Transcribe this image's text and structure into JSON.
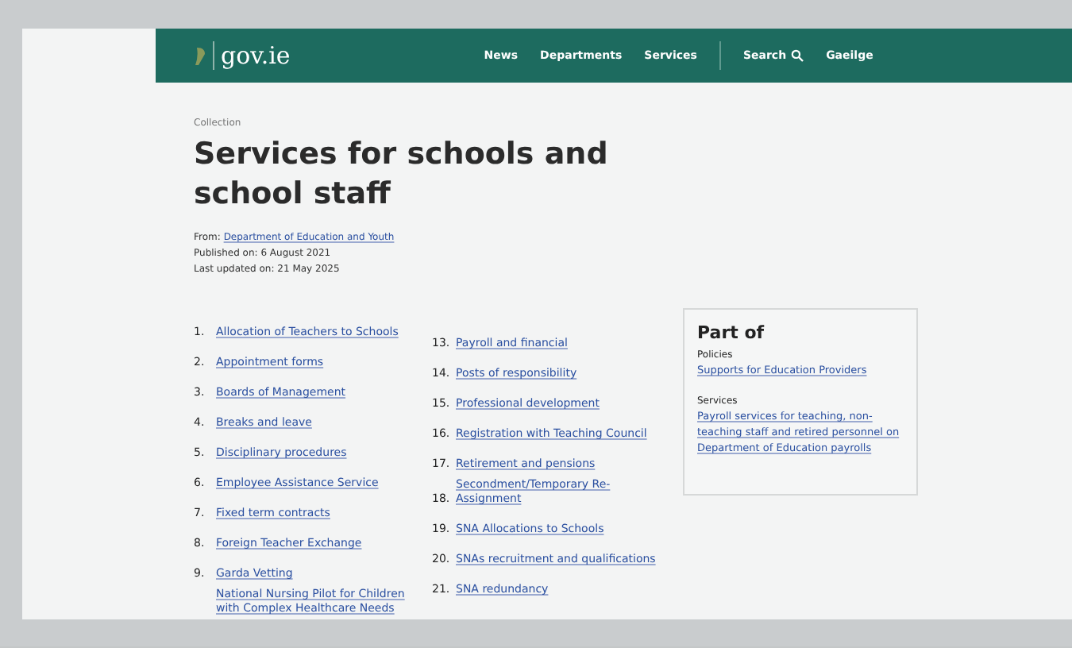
{
  "header": {
    "logo": "gov.ie",
    "nav": [
      {
        "label": "News",
        "kind": "link"
      },
      {
        "label": "Departments",
        "kind": "link"
      },
      {
        "label": "Services",
        "kind": "link"
      },
      {
        "kind": "divider"
      },
      {
        "label": "Search",
        "kind": "search"
      },
      {
        "label": "Gaeilge",
        "kind": "link"
      }
    ]
  },
  "page": {
    "label": "Collection",
    "title": "Services for schools and school staff",
    "from_label": "From:",
    "from_link": "Department of Education and Youth",
    "published": "Published on: 6 August 2021",
    "updated": "Last updated on: 21 May 2025"
  },
  "columns": [
    [
      {
        "number": "1.",
        "text": "Allocation of Teachers to Schools"
      },
      {
        "number": "2.",
        "text": "Appointment forms"
      },
      {
        "number": "3.",
        "text": "Boards of Management"
      },
      {
        "number": "4.",
        "text": "Breaks and leave"
      },
      {
        "number": "5.",
        "text": "Disciplinary procedures"
      },
      {
        "number": "6.",
        "text": "Employee Assistance Service"
      },
      {
        "number": "7.",
        "text": "Fixed term contracts"
      },
      {
        "number": "8.",
        "text": "Foreign Teacher Exchange"
      },
      {
        "number": "9.",
        "text": "Garda Vetting"
      },
      {
        "text": "National Nursing Pilot for Children with Complex Healthcare Needs"
      }
    ],
    [
      {
        "number": "13.",
        "text": "Payroll and financial"
      },
      {
        "number": "14.",
        "text": "Posts of responsibility"
      },
      {
        "number": "15.",
        "text": "Professional development"
      },
      {
        "number": "16.",
        "text": "Registration with Teaching Council"
      },
      {
        "number": "17.",
        "text": "Retirement and pensions"
      },
      {
        "number": "18.",
        "text": "Secondment/Temporary Re-Assignment"
      },
      {
        "number": "19.",
        "text": "SNA Allocations to Schools"
      },
      {
        "number": "20.",
        "text": "SNAs recruitment and qualifications"
      },
      {
        "number": "21.",
        "text": "SNA redundancy"
      }
    ]
  ],
  "part_of": {
    "title": "Part of",
    "groups": [
      {
        "heading": "Policies",
        "links": [
          "Supports for Education Providers"
        ]
      },
      {
        "heading": "Services",
        "links": [
          "Payroll services for teaching, non-teaching staff and retired personnel on Department of Education payrolls"
        ]
      }
    ]
  }
}
